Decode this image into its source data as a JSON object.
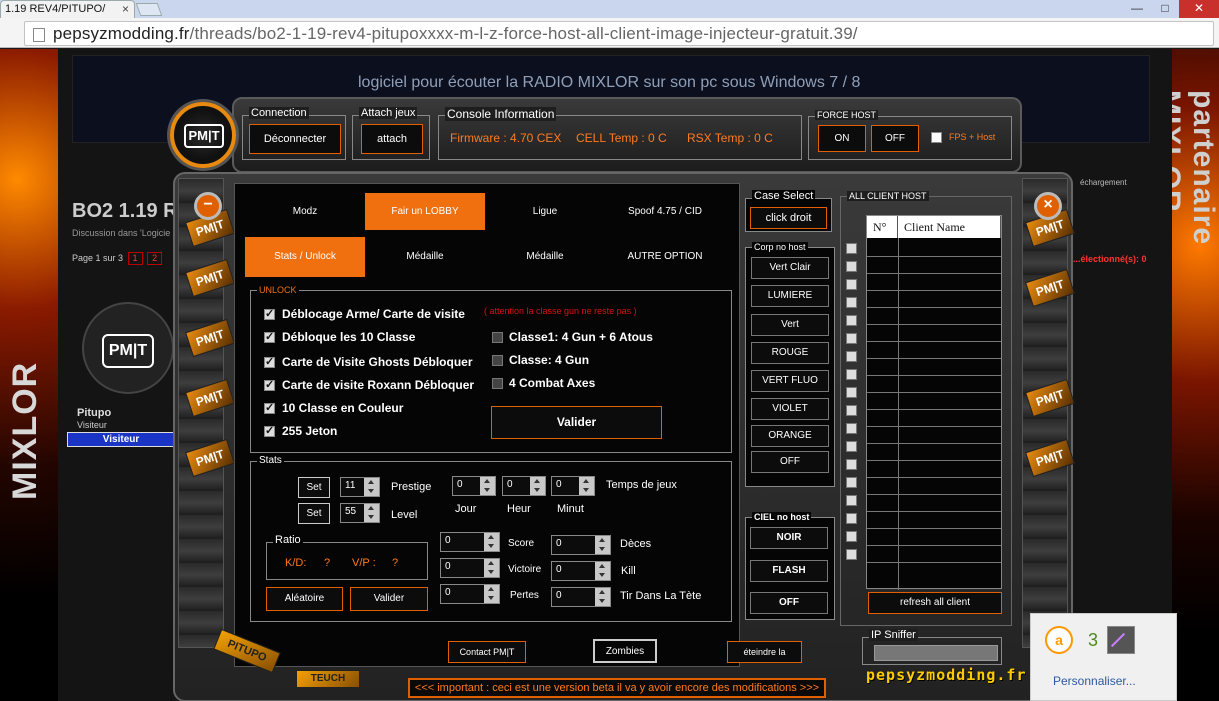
{
  "browser": {
    "tab_title": "1.19 REV4/PITUPO/",
    "tab_close": "×",
    "win_min": "—",
    "win_max": "□",
    "win_close": "✕",
    "url_host": "pepsyzmodding.fr",
    "url_path": "/threads/bo2-1-19-rev4-pitupoxxxx-m-l-z-force-host-all-client-image-injecteur-gratuit.39/"
  },
  "forum": {
    "banner_text": "logiciel pour écouter la RADIO MIXLOR sur son pc sous Windows 7 / 8",
    "title": "BO2 1.19 R",
    "subtitle": "Discussion dans 'Logicie",
    "page_label": "Page 1 sur 3",
    "pages": [
      "1",
      "2"
    ],
    "user_name": "Pitupo",
    "user_role": "Visiteur",
    "user_badge": "Visiteur",
    "avatar_logo": "PM|T",
    "download_label": "échargement",
    "selected_count": "essage ...électionné(s): 0",
    "side_brand": "MIXLOR",
    "side_brand_right": "partenaire MIXLOR"
  },
  "popup": {
    "icon_a": "a",
    "icon_b": "3",
    "label": "Personnaliser..."
  },
  "tool": {
    "logo": "PM|T",
    "connection": {
      "title": "Connection",
      "button": "Déconnecter"
    },
    "attach": {
      "title": "Attach jeux",
      "button": "attach"
    },
    "console": {
      "title": "Console Information",
      "firmware": "Firmware : 4.70 CEX",
      "cell_temp": "CELL Temp : 0 C",
      "rsx_temp": "RSX Temp : 0 C"
    },
    "force_host": {
      "title": "FORCE HOST",
      "on": "ON",
      "off": "OFF",
      "fps_label": "FPS + Host"
    },
    "side_close_left": "−",
    "side_close_right": "×",
    "nav_tabs": [
      "Modz",
      "Fair un LOBBY",
      "Ligue",
      "Spoof 4.75 / CID"
    ],
    "sub_tabs": [
      "Stats / Unlock",
      "Médaille",
      "Médaille",
      "AUTRE OPTION"
    ],
    "unlock": {
      "title": "UNLOCK",
      "warning": "( attention la classe gun ne reste pas )",
      "items": [
        "Déblocage Arme/ Carte de visite",
        "Débloque les 10 Classe",
        "Carte de Visite Ghosts Débloquer",
        "Carte de visite Roxann Débloquer",
        "10 Classe en Couleur",
        "255 Jeton"
      ],
      "class_items": [
        "Classe1: 4 Gun + 6 Atous",
        "Classe: 4 Gun",
        "4 Combat Axes"
      ],
      "validate": "Valider"
    },
    "stats": {
      "title": "Stats",
      "set": "Set",
      "prestige_value": "11",
      "prestige_label": "Prestige",
      "level_value": "55",
      "level_label": "Level",
      "game_time_label": "Temps de jeux",
      "day_value": "0",
      "hour_value": "0",
      "minute_value": "0",
      "day_label": "Jour",
      "hour_label": "Heur",
      "minute_label": "Minut",
      "ratio_title": "Ratio",
      "kd_label": "K/D:",
      "kd_value": "?",
      "vp_label": "V/P :",
      "vp_value": "?",
      "score_label": "Score",
      "victory_label": "Victoire",
      "losses_label": "Pertes",
      "deaths_label": "Dèces",
      "kill_label": "Kill",
      "head_label": "Tir Dans La Tète",
      "field_zero": "0",
      "random_btn": "Aléatoire",
      "validate_btn": "Valider"
    },
    "bottom_buttons": {
      "contact": "Contact PM|T",
      "zombies": "Zombies",
      "turn_off": "éteindre la"
    },
    "case_select": {
      "title": "Case Select",
      "button": "click droit"
    },
    "corp_no_host": {
      "title": "Corp no host",
      "items": [
        "Vert Clair",
        "LUMIERE",
        "Vert",
        "ROUGE",
        "VERT FLUO",
        "VIOLET",
        "ORANGE",
        "OFF"
      ]
    },
    "ciel_no_host": {
      "title": "CIEL no host",
      "items": [
        "NOIR",
        "FLASH",
        "OFF"
      ]
    },
    "all_client": {
      "title": "ALL CLIENT HOST",
      "col_num": "N°",
      "col_name": "Client Name",
      "refresh": "refresh all client"
    },
    "ip_sniffer": "IP Sniffer",
    "beta_notice": "<<< important : ceci est une version beta il va y avoir encore des modifications >>>",
    "brand_footer": "pepsyzmodding.fr",
    "pitupo_tag": "PITUPO",
    "teuch_tag": "TEUCH"
  }
}
